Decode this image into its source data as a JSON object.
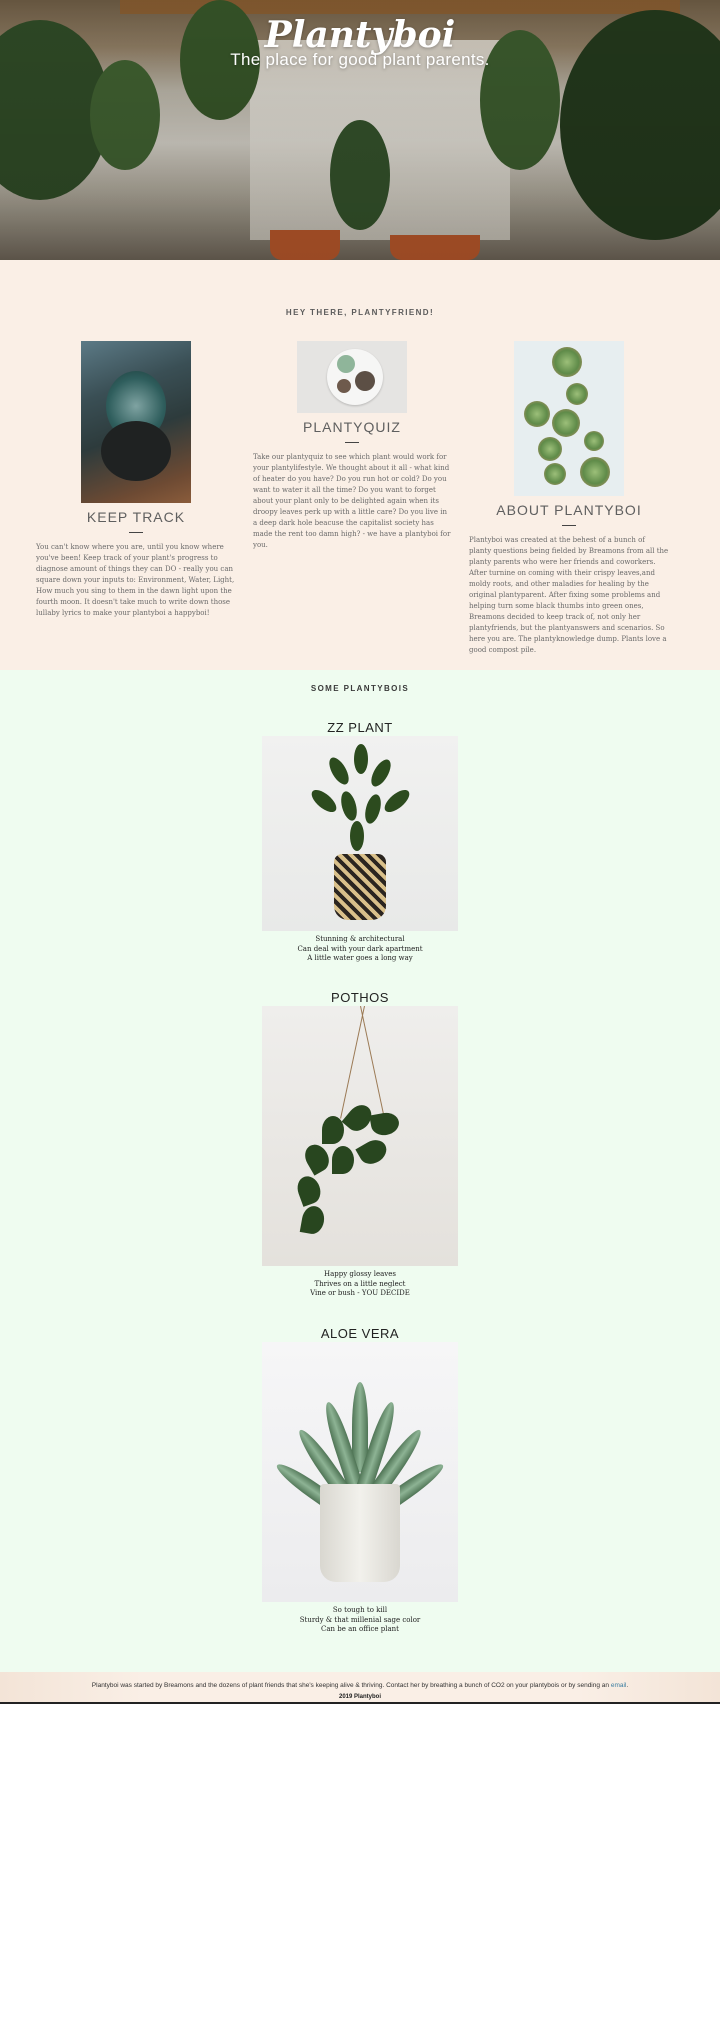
{
  "hero": {
    "title": "Plantyboi",
    "subtitle": "The place for good plant parents."
  },
  "intro": {
    "heading": "HEY THERE, PLANTYFRIEND!",
    "columns": [
      {
        "title": "KEEP TRACK",
        "text": "You can't know where you are, until you know where you've been! Keep track of your plant's progress to diagnose amount of things they can DO - really you can square down your inputs to: Environment, Water, Light, How much you sing to them in the dawn light upon the fourth moon. It doesn't take much to write down those lullaby lyrics to make your plantyboi a happyboi!"
      },
      {
        "title": "PLANTYQUIZ",
        "text": "Take our plantyquiz to see which plant would work for your plantylifestyle. We thought about it all - what kind of heater do you have? Do you run hot or cold? Do you want to water it all the time? Do you want to forget about your plant only to be delighted again when its droopy leaves perk up with a little care? Do you live in a deep dark hole beacuse the capitalist society has made the rent too damn high? - we have a plantyboi for you."
      },
      {
        "title": "ABOUT PLANTYBOI",
        "text": "Plantyboi was created at the behest of a bunch of planty questions being fielded by Breamons from all the planty parents who were her friends and coworkers. After turnine on coming with their crispy leaves,and moldy roots, and other maladies for healing by the original plantyparent. After fixing some problems and helping turn some black thumbs into green ones, Breamons decided to keep track of, not only her plantyfriends, but the plantyanswers and scenarios. So here you are. The plantyknowledge dump. Plants love a good compost pile."
      }
    ]
  },
  "plants": {
    "heading": "SOME PLANTYBOIS",
    "items": [
      {
        "name": "ZZ PLANT",
        "notes": [
          "Stunning & architectural",
          "Can deal with your dark apartment",
          "A little water goes a long way"
        ]
      },
      {
        "name": "POTHOS",
        "notes": [
          "Happy glossy leaves",
          "Thrives on a little neglect",
          "Vine or bush - YOU DECIDE"
        ]
      },
      {
        "name": "ALOE VERA",
        "notes": [
          "So tough to kill",
          "Sturdy & that millenial sage color",
          "Can be an office plant"
        ]
      }
    ]
  },
  "footer": {
    "text": "Plantyboi was started by Breamons and the dozens of plant friends that she's keeping alive & thriving. Contact her by breathing a bunch of CO2 on your plantybois or by sending an ",
    "link_label": "email",
    "text_end": ".",
    "copyright": "2019 Plantyboi"
  },
  "colors": {
    "intro_bg": "#faefe6",
    "plants_bg": "#effcf0",
    "link": "#3b7ea1"
  }
}
